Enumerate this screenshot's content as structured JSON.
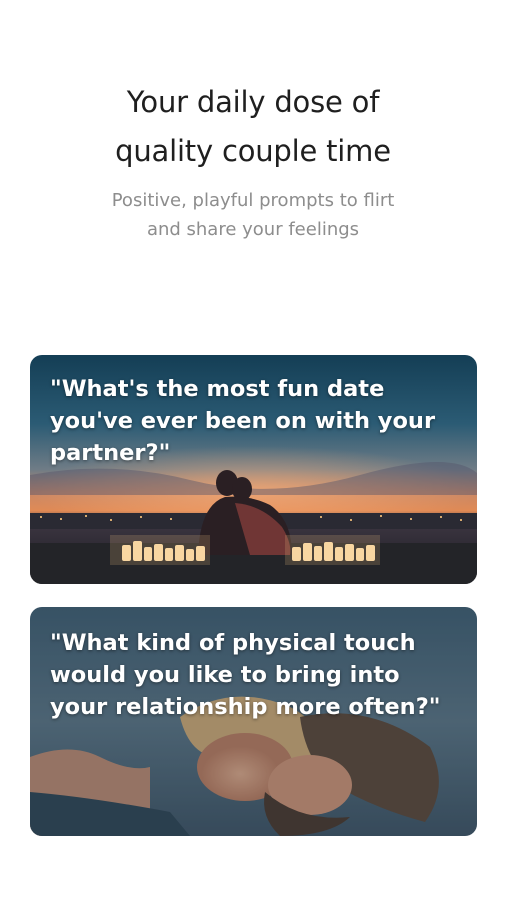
{
  "hero": {
    "title_line1": "Your daily dose of",
    "title_line2": "quality couple time",
    "subtitle_line1": "Positive, playful prompts to flirt",
    "subtitle_line2": "and share your feelings"
  },
  "cards": [
    {
      "quote": "\"What's the most fun date\nyou've ever been on with your\npartner?\"",
      "image": "couple-city-sunset-candles"
    },
    {
      "quote": "\"What kind of physical touch\nwould you like to bring into\nyour relationship more often?\"",
      "image": "couple-embracing-closeup"
    }
  ],
  "colors": {
    "title": "#1f1f1f",
    "subtitle": "#8d8d8d",
    "quote_text": "#ffffff"
  }
}
